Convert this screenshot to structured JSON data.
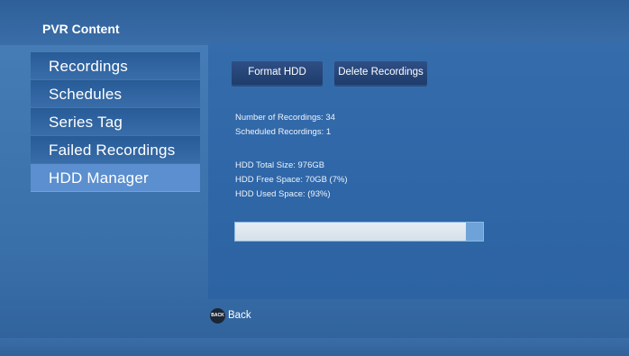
{
  "header": {
    "title": "PVR Content"
  },
  "sidebar": {
    "items": [
      {
        "label": "Recordings"
      },
      {
        "label": "Schedules"
      },
      {
        "label": "Series Tag"
      },
      {
        "label": "Failed Recordings"
      },
      {
        "label": "HDD Manager",
        "active": true
      }
    ]
  },
  "actions": {
    "format_label": "Format HDD",
    "delete_label": "Delete Recordings"
  },
  "stats": {
    "recordings": "Number of Recordings: 34",
    "scheduled": "Scheduled Recordings: 1",
    "total": "HDD Total Size: 976GB",
    "free": "HDD Free Space: 70GB (7%)",
    "used": "HDD Used Space: (93%)"
  },
  "usage": {
    "used_fraction": 0.93
  },
  "footer": {
    "back_icon_text": "BACK",
    "back_label": "Back"
  },
  "colors": {
    "panel": "#2f67a8",
    "sidebar_active": "#5b8fcf",
    "button": "#2e4f86",
    "bar_used": "#e6edf3",
    "bar_free": "#6ea3d9"
  }
}
